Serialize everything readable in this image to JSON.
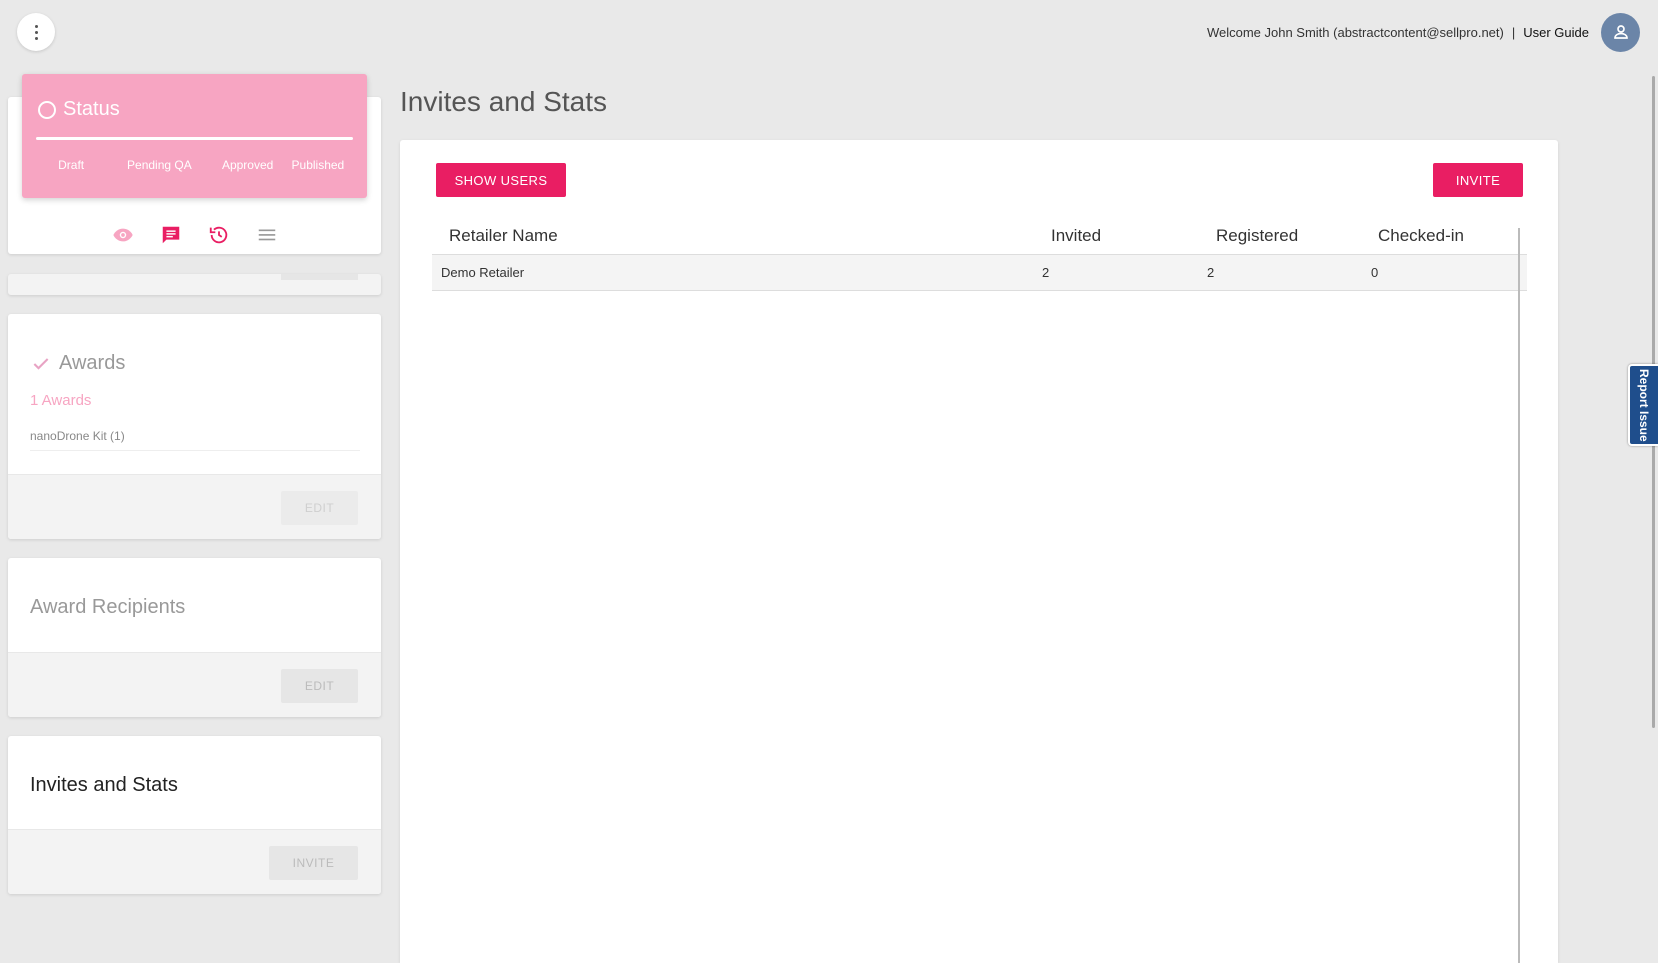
{
  "header": {
    "welcome": "Welcome John Smith (abstractcontent@sellpro.net)",
    "separator": "|",
    "user_guide": "User Guide"
  },
  "status": {
    "title": "Status",
    "steps": [
      "Draft",
      "Pending QA",
      "Approved",
      "Published"
    ],
    "accent_color": "#f7a5c2"
  },
  "awards": {
    "title": "Awards",
    "count": "1 Awards",
    "items": [
      "nanoDrone Kit (1)"
    ],
    "edit_label": "EDIT"
  },
  "award_recipients": {
    "title": "Award Recipients",
    "edit_label": "EDIT"
  },
  "invites_side": {
    "title": "Invites and Stats",
    "invite_label": "INVITE"
  },
  "main": {
    "title": "Invites and Stats",
    "show_users_label": "SHOW USERS",
    "invite_label": "INVITE",
    "table": {
      "columns": [
        "Retailer Name",
        "Invited",
        "Registered",
        "Checked-in"
      ],
      "rows": [
        [
          "Demo Retailer",
          "2",
          "2",
          "0"
        ]
      ]
    }
  },
  "report_issue": "Report Issue",
  "colors": {
    "primary": "#e91e63",
    "avatar": "#6b85a8",
    "report_tab": "#1f4e8c"
  }
}
